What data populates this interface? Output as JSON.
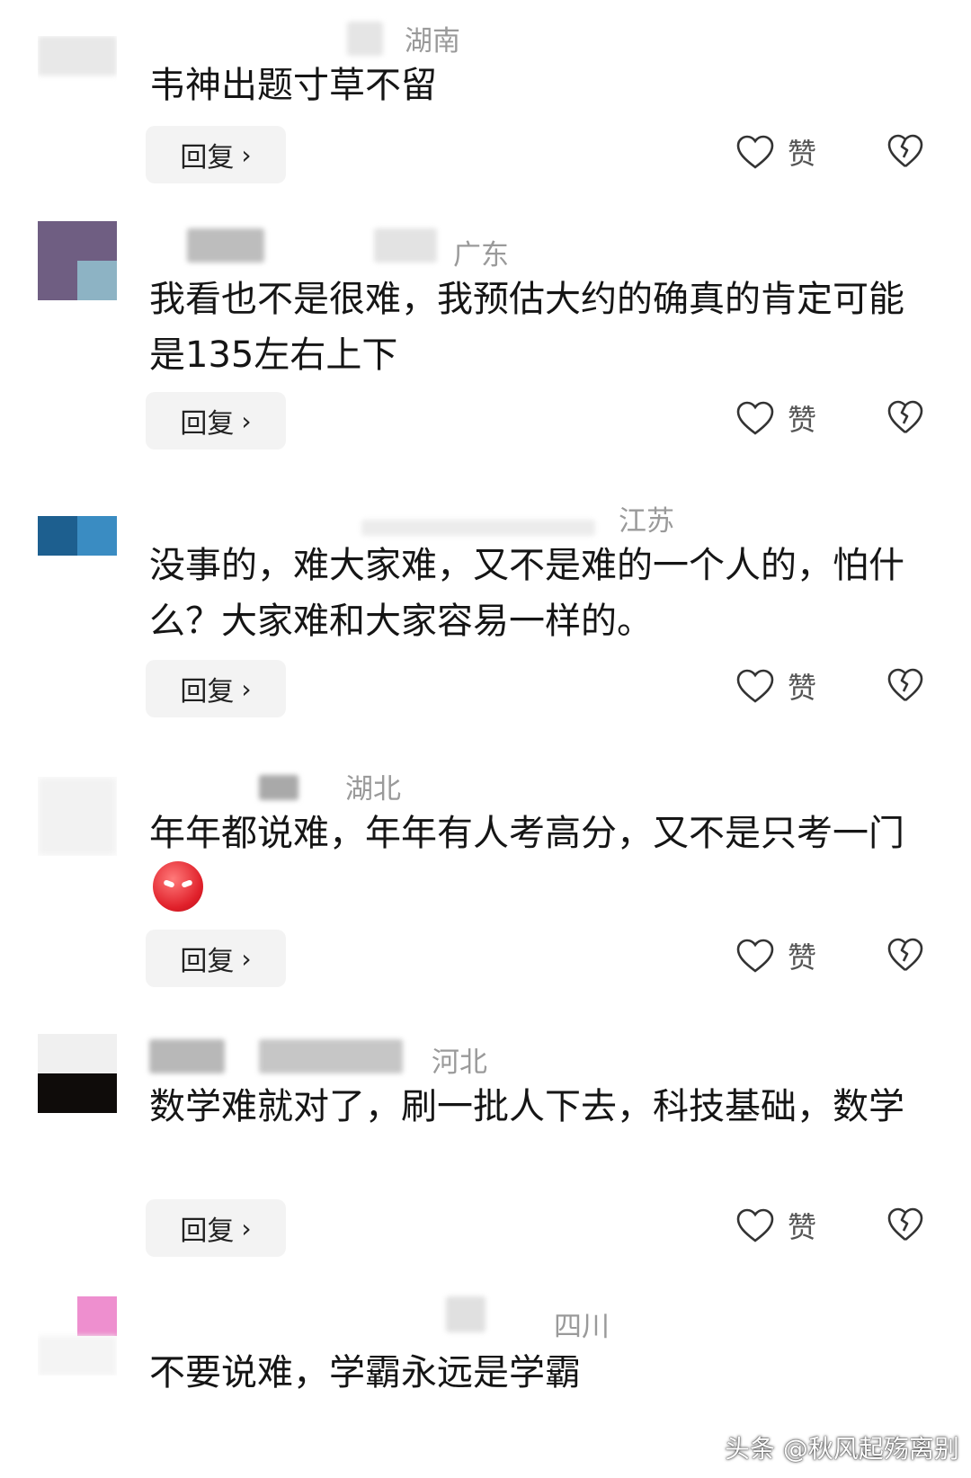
{
  "comments": [
    {
      "region": "湖南",
      "text": "韦神出题寸草不留",
      "reply_label": "回复",
      "like_label": "赞"
    },
    {
      "region": "广东",
      "text": "我看也不是很难，我预估大约的确真的肯定可能是135左右上下",
      "reply_label": "回复",
      "like_label": "赞"
    },
    {
      "region": "江苏",
      "text": "没事的，难大家难，又不是难的一个人的，怕什么？大家难和大家容易一样的。",
      "reply_label": "回复",
      "like_label": "赞"
    },
    {
      "region": "湖北",
      "text": "年年都说难，年年有人考高分，又不是只考一门",
      "reply_label": "回复",
      "like_label": "赞"
    },
    {
      "region": "河北",
      "text": "数学难就对了，刷一批人下去，科技基础，数学",
      "reply_label": "回复",
      "like_label": "赞"
    },
    {
      "region": "四川",
      "text": "不要说难，学霸永远是学霸"
    }
  ],
  "watermark": "头条 @秋风起殇离别",
  "icons": {
    "like": "heart-outline-icon",
    "dislike": "broken-heart-icon",
    "reply_arrow": "chevron-right-icon"
  },
  "colors": {
    "region_text": "#9a9a9a",
    "reply_bg": "#f3f3f3",
    "icon_stroke": "#333333"
  }
}
